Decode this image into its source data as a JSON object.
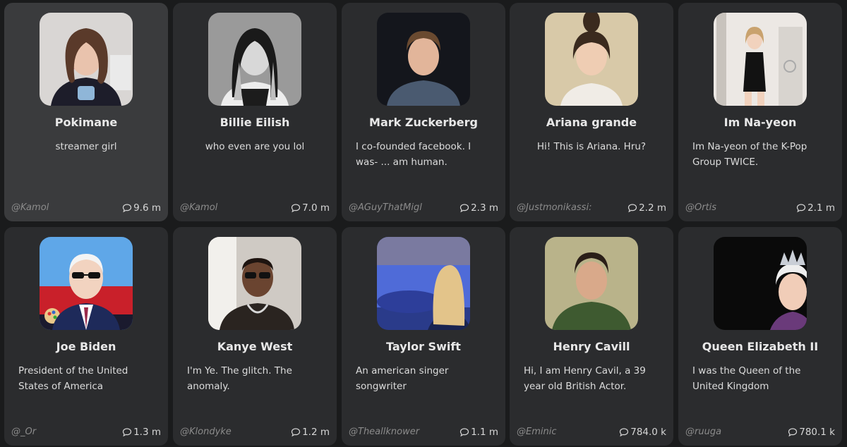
{
  "characters": [
    {
      "name": "Pokimane",
      "description": "streamer girl",
      "author": "@Kamol",
      "chats": "9.6 m",
      "avatar": "portrait-woman-streamer",
      "colors": {
        "bg": "#d9d6d4",
        "hair": "#5a3a2a",
        "skin": "#e9c3ad",
        "shirt": "#1d1d2a"
      }
    },
    {
      "name": "Billie Eilish",
      "description": "who even are you lol",
      "author": "@Kamol",
      "chats": "7.0 m",
      "avatar": "portrait-woman-grayscale",
      "colors": {
        "bg": "#9a9a9a",
        "hair": "#1a1a1a",
        "skin": "#d8d8d8",
        "shirt": "#ededed"
      }
    },
    {
      "name": "Mark Zuckerberg",
      "description": "I co-founded facebook. I was- ... am human.",
      "author": "@AGuyThatMigl",
      "chats": "2.3 m",
      "avatar": "portrait-man-dark-bg",
      "colors": {
        "bg": "#14161c",
        "hair": "#6a4a30",
        "skin": "#e2b59a",
        "shirt": "#4a5a70"
      }
    },
    {
      "name": "Ariana grande",
      "description": "Hi! This is Ariana. Hru?",
      "author": "@Justmonikassi:",
      "chats": "2.2 m",
      "avatar": "portrait-woman-ponytail",
      "colors": {
        "bg": "#d8c9a8",
        "hair": "#3a2a1e",
        "skin": "#efcdb3",
        "shirt": "#f0ece6"
      }
    },
    {
      "name": "Im Na-yeon",
      "description": "Im Na-yeon of the K-Pop Group TWICE.",
      "author": "@Ortis",
      "chats": "2.1 m",
      "avatar": "portrait-woman-full-body",
      "colors": {
        "bg": "#ece8e4",
        "hair": "#c9a26e",
        "skin": "#f1d2bd",
        "shirt": "#121212"
      }
    },
    {
      "name": "Joe Biden",
      "description": "President of the United States of America",
      "author": "@_Or",
      "chats": "1.3 m",
      "avatar": "portrait-man-sunglasses-cartoon",
      "colors": {
        "bg": "#5fa7e8",
        "hair": "#f4f4f4",
        "skin": "#f2d3c0",
        "shirt": "#1e2a5a"
      }
    },
    {
      "name": "Kanye West",
      "description": "I'm Ye. The glitch. The anomaly.",
      "author": "@Klondyke",
      "chats": "1.2 m",
      "avatar": "portrait-man-sunglasses-chain",
      "colors": {
        "bg": "#cfcac4",
        "hair": "#1e1410",
        "skin": "#6a4430",
        "shirt": "#2a2420"
      }
    },
    {
      "name": "Taylor Swift",
      "description": "An american singer songwriter",
      "author": "@Theallknower",
      "chats": "1.1 m",
      "avatar": "portrait-woman-blonde-car",
      "colors": {
        "bg": "#2a3b8a",
        "hair": "#e3c48a",
        "skin": "#f2d6c2",
        "shirt": "#1a2450"
      }
    },
    {
      "name": "Henry Cavill",
      "description": "Hi, I am Henry Cavil, a 39 year old British Actor.",
      "author": "@Eminic",
      "chats": "784.0 k",
      "avatar": "portrait-man-green-shirt",
      "colors": {
        "bg": "#b9b38a",
        "hair": "#2a1e18",
        "skin": "#d9a98a",
        "shirt": "#3e5a30"
      }
    },
    {
      "name": "Queen Elizabeth II",
      "description": "I was the Queen of the United Kingdom",
      "author": "@ruuga",
      "chats": "780.1 k",
      "avatar": "portrait-woman-crown",
      "colors": {
        "bg": "#0a0a0a",
        "hair": "#eeeeee",
        "skin": "#f1cdb8",
        "shirt": "#6a3a7a"
      }
    }
  ]
}
